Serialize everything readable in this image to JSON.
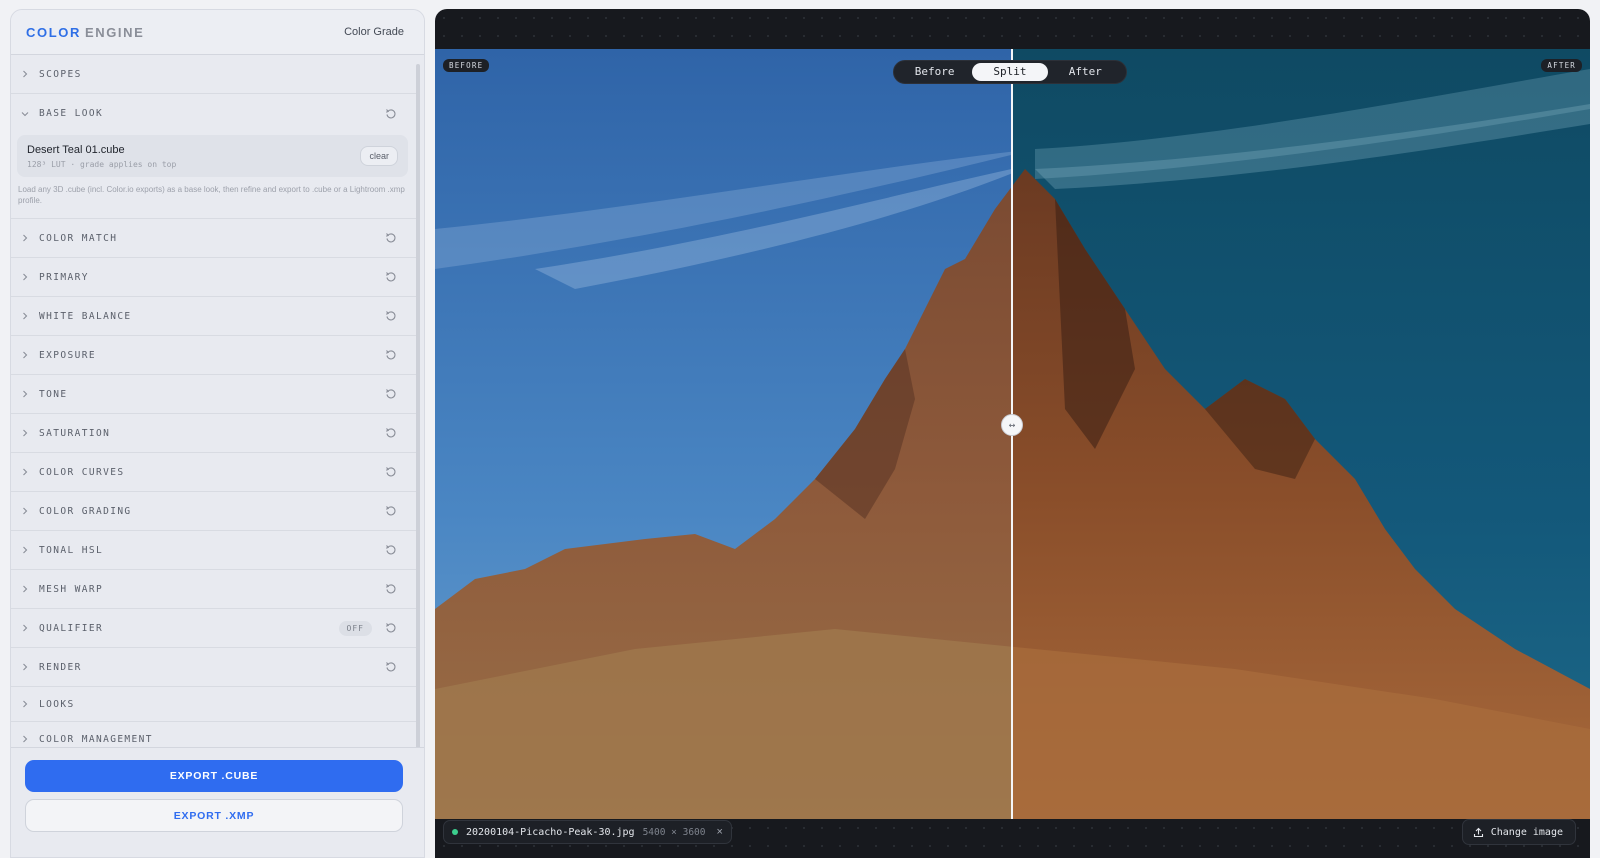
{
  "panel": {
    "brand_primary": "COLOR",
    "brand_secondary": "ENGINE",
    "mode": "Color Grade",
    "sections": [
      {
        "label": "SCOPES",
        "reset": false,
        "expanded": false
      },
      {
        "label": "BASE LOOK",
        "reset": true,
        "expanded": true
      },
      {
        "label": "COLOR MATCH",
        "reset": true
      },
      {
        "label": "PRIMARY",
        "reset": true
      },
      {
        "label": "WHITE BALANCE",
        "reset": true
      },
      {
        "label": "EXPOSURE",
        "reset": true
      },
      {
        "label": "TONE",
        "reset": true
      },
      {
        "label": "SATURATION",
        "reset": true
      },
      {
        "label": "COLOR CURVES",
        "reset": true
      },
      {
        "label": "COLOR GRADING",
        "reset": true
      },
      {
        "label": "TONAL HSL",
        "reset": true
      },
      {
        "label": "MESH WARP",
        "reset": true
      },
      {
        "label": "QUALIFIER",
        "reset": true,
        "badge": "OFF"
      },
      {
        "label": "RENDER",
        "reset": true
      },
      {
        "label": "LOOKS",
        "reset": false
      },
      {
        "label": "COLOR MANAGEMENT",
        "reset": false
      }
    ],
    "base_look": {
      "lut_name": "Desert Teal 01.cube",
      "lut_meta": "128³ LUT · grade applies on top",
      "clear_label": "clear",
      "help_text": "Load any 3D .cube (incl. Color.io exports) as a base look, then refine and export to .cube or a Lightroom .xmp profile."
    },
    "export_cube_label": "EXPORT .CUBE",
    "export_xmp_label": "EXPORT .XMP",
    "accent_color": "#2f6cf0"
  },
  "viewer": {
    "before_tag": "BEFORE",
    "after_tag": "AFTER",
    "modes": [
      "Before",
      "Split",
      "After"
    ],
    "active_mode": "Split",
    "split_position": 0.5,
    "handle_glyph": "↔",
    "file_name": "20200104-Picacho-Peak-30.jpg",
    "file_dims": "5400 × 3600",
    "close_glyph": "×",
    "change_image_label": "Change image"
  }
}
